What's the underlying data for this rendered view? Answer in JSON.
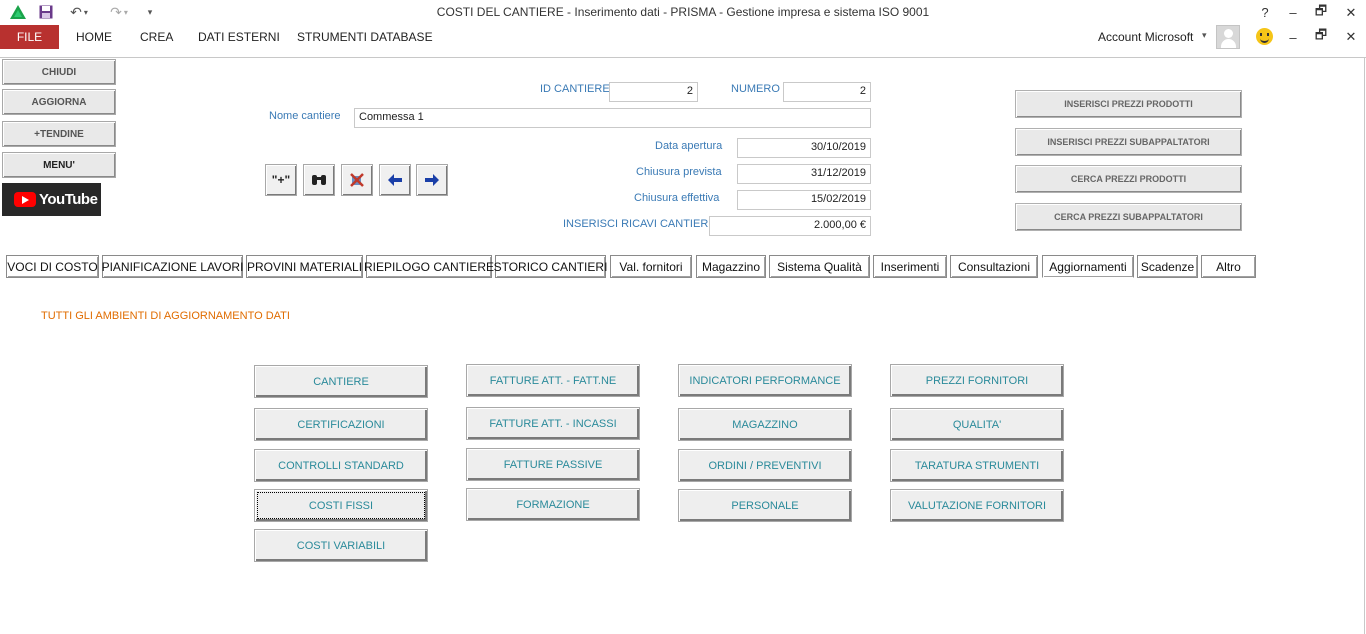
{
  "window": {
    "title": "COSTI DEL CANTIERE - Inserimento dati - PRISMA - Gestione impresa e sistema ISO 9001",
    "help": "?",
    "minimize": "–",
    "restore": "🗗",
    "close": "✕"
  },
  "quick_access": {
    "save_icon": "floppy-icon",
    "undo_icon": "undo-icon",
    "redo_icon": "redo-icon"
  },
  "ribbon": {
    "file": "FILE",
    "tabs": [
      "HOME",
      "CREA",
      "DATI ESTERNI",
      "STRUMENTI DATABASE"
    ],
    "account": "Account Microsoft"
  },
  "sidebar": {
    "close": "CHIUDI",
    "refresh": "AGGIORNA",
    "dropdowns": "+TENDINE",
    "menu": "MENU'",
    "youtube": "YouTube"
  },
  "header": {
    "id_label": "ID CANTIERE",
    "id_value": "2",
    "number_label": "NUMERO",
    "number_value": "2",
    "name_label": "Nome cantiere",
    "name_value": "Commessa 1",
    "open_label": "Data apertura",
    "open_value": "30/10/2019",
    "planned_label": "Chiusura prevista",
    "planned_value": "31/12/2019",
    "actual_label": "Chiusura effettiva",
    "actual_value": "15/02/2019",
    "revenue_label": "INSERISCI RICAVI CANTIERE",
    "revenue_value": "2.000,00 €"
  },
  "nav_buttons": {
    "add": "\"+\"",
    "find": "👓",
    "delete": "✗",
    "prev": "←",
    "next": "→"
  },
  "right_buttons": [
    "INSERISCI PREZZI PRODOTTI",
    "INSERISCI PREZZI SUBAPPALTATORI",
    "CERCA PREZZI PRODOTTI",
    "CERCA PREZZI SUBAPPALTATORI"
  ],
  "tabs": [
    "VOCI DI COSTO",
    "PIANIFICAZIONE LAVORI",
    "PROVINI MATERIALI",
    "RIEPILOGO CANTIERE",
    "STORICO CANTIERI",
    "Val. fornitori",
    "Magazzino",
    "Sistema Qualità",
    "Inserimenti",
    "Consultazioni",
    "Aggiornamenti",
    "Scadenze",
    "Altro"
  ],
  "section_title": "TUTTI GLI AMBIENTI DI AGGIORNAMENTO DATI",
  "grid": {
    "col1": [
      "CANTIERE",
      "CERTIFICAZIONI",
      "CONTROLLI STANDARD",
      "COSTI FISSI",
      "COSTI VARIABILI"
    ],
    "col2": [
      "FATTURE ATT. - FATT.NE",
      "FATTURE ATT. - INCASSI",
      "FATTURE PASSIVE",
      "FORMAZIONE"
    ],
    "col3": [
      "INDICATORI PERFORMANCE",
      "MAGAZZINO",
      "ORDINI / PREVENTIVI",
      "PERSONALE"
    ],
    "col4": [
      "PREZZI FORNITORI",
      "QUALITA'",
      "TARATURA STRUMENTI",
      "VALUTAZIONE FORNITORI"
    ]
  }
}
